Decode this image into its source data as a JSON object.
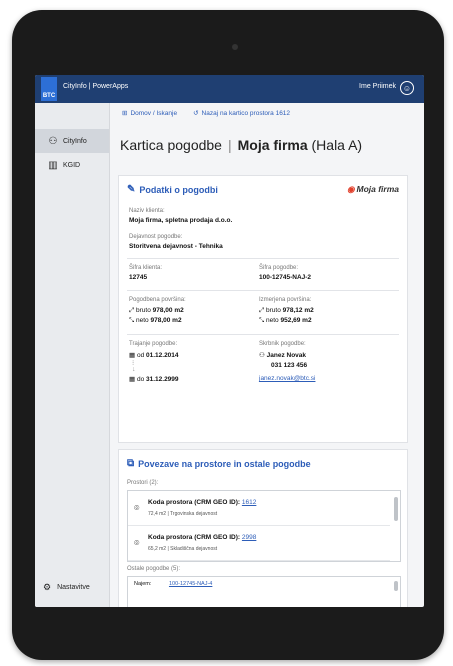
{
  "header": {
    "app_title": "CityInfo | PowerApps",
    "user_name": "Ime Priimek",
    "logo_text": "BTC"
  },
  "sidebar": {
    "items": [
      {
        "label": "CityInfo",
        "icon": "person-icon",
        "active": true
      },
      {
        "label": "KGID",
        "icon": "building-icon",
        "active": false
      }
    ],
    "settings_label": "Nastavitve"
  },
  "nav": {
    "home_label": "Domov / Iskanje",
    "back_label": "Nazaj na kartico prostora 1612"
  },
  "page": {
    "title": "Kartica pogodbe",
    "firm": "Moja firma",
    "hall": "(Hala A)"
  },
  "contract_card": {
    "title": "Podatki o pogodbi",
    "brand": "Moja firma",
    "client_name_label": "Naziv klienta:",
    "client_name": "Moja firma, spletna prodaja d.o.o.",
    "activity_label": "Dejavnost pogodbe:",
    "activity": "Storitvena dejavnost - Tehnika",
    "client_code_label": "Šifra klienta:",
    "client_code": "12745",
    "contract_code_label": "Šifra pogodbe:",
    "contract_code": "100-12745-NAJ-2",
    "contracted_area_label": "Pogodbena površina:",
    "contracted_gross_prefix": "bruto",
    "contracted_gross": "978,00 m2",
    "contracted_net_prefix": "neto",
    "contracted_net": "978,00 m2",
    "measured_area_label": "Izmerjena površina:",
    "measured_gross_prefix": "bruto",
    "measured_gross": "978,12 m2",
    "measured_net_prefix": "neto",
    "measured_net": "952,69 m2",
    "duration_label": "Trajanje pogodbe:",
    "from_prefix": "od",
    "from_date": "01.12.2014",
    "to_prefix": "do",
    "to_date": "31.12.2999",
    "manager_label": "Skrbnik pogodbe:",
    "manager_name": "Janez Novak",
    "manager_phone": "031 123 456",
    "manager_email": "janez.novak@btc.si"
  },
  "links_card": {
    "title": "Povezave na prostore in ostale pogodbe",
    "spaces_label": "Prostori (2):",
    "spaces": [
      {
        "title_prefix": "Koda prostora (CRM GEO ID):",
        "code": "1612",
        "detail": "72,4 m2 | Trgovinska dejavnost"
      },
      {
        "title_prefix": "Koda prostora (CRM GEO ID):",
        "code": "2998",
        "detail": "65,2 m2 | Skladiščna dejavnost"
      }
    ],
    "other_label": "Ostale pogodbe (5):",
    "other": [
      {
        "type": "Najem:",
        "code": "100-12745-NAJ-4"
      }
    ]
  }
}
